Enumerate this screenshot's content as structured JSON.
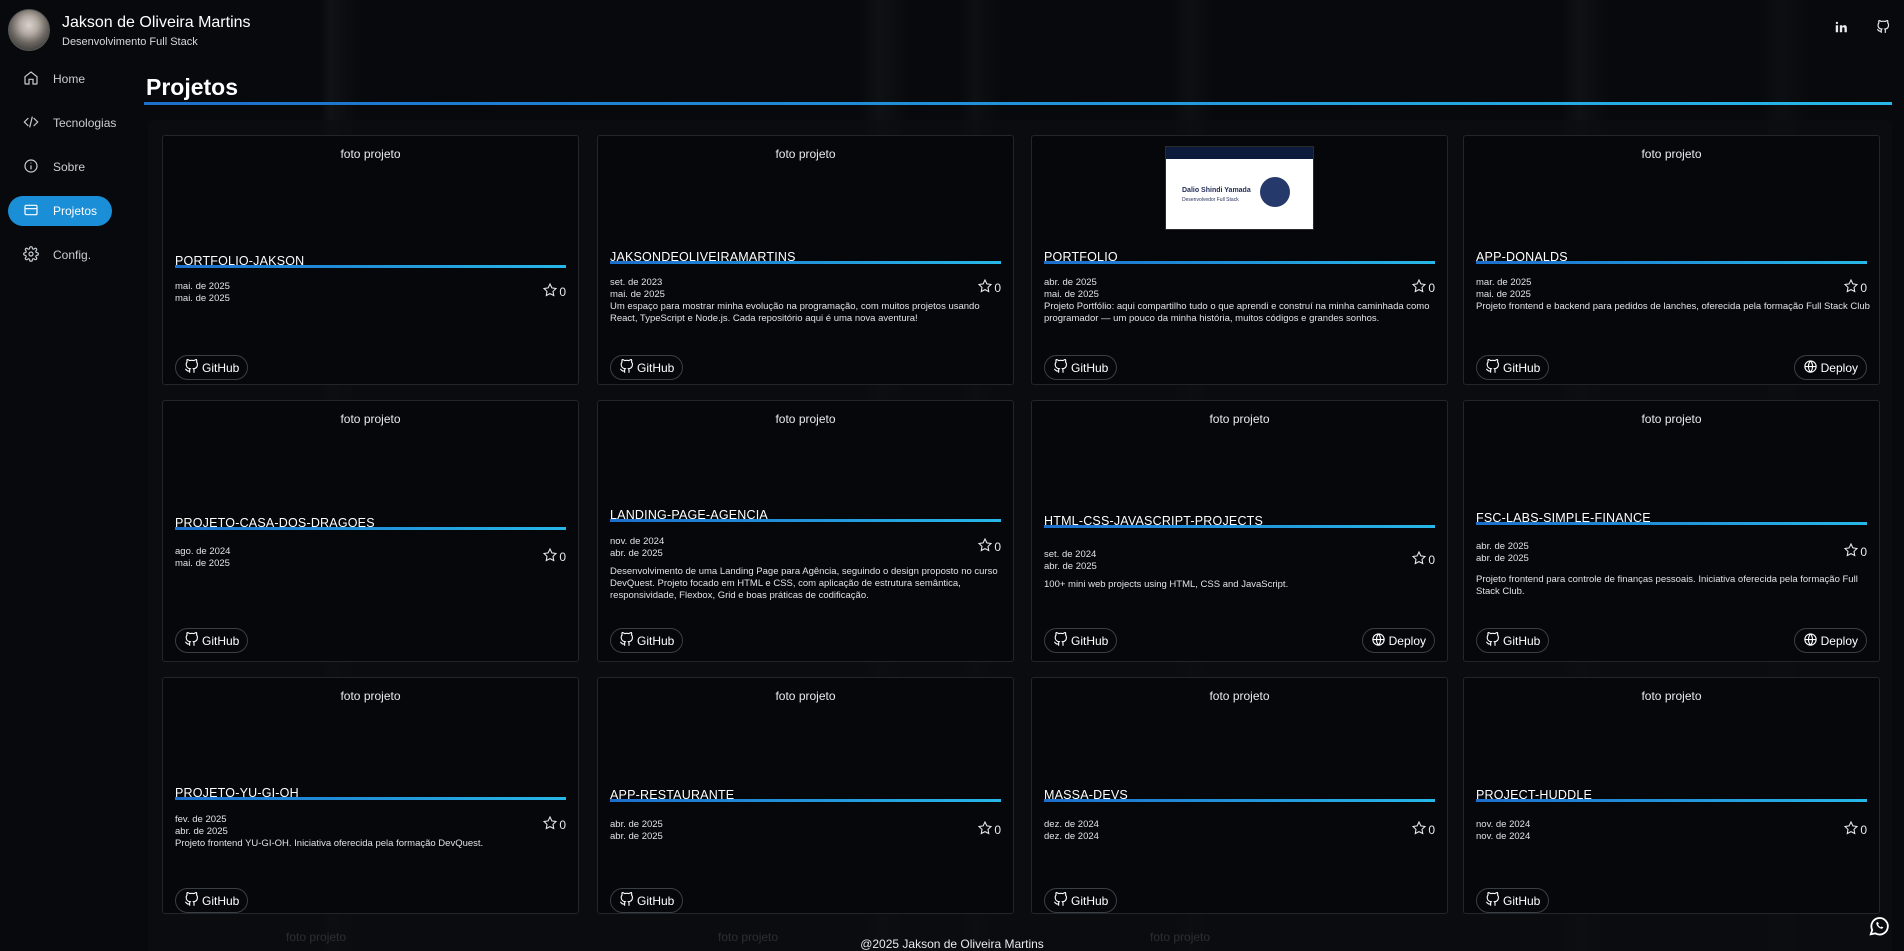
{
  "header": {
    "name": "Jakson de Oliveira Martins",
    "role": "Desenvolvimento Full Stack"
  },
  "sidebar": {
    "items": [
      {
        "label": "Home",
        "icon": "home-icon"
      },
      {
        "label": "Tecnologias",
        "icon": "code-icon"
      },
      {
        "label": "Sobre",
        "icon": "info-icon"
      },
      {
        "label": "Projetos",
        "icon": "card-icon",
        "active": true
      },
      {
        "label": "Config.",
        "icon": "gear-icon"
      }
    ]
  },
  "main": {
    "title": "Projetos",
    "image_alt": "foto projeto",
    "github_label": "GitHub",
    "deploy_label": "Deploy",
    "projects": [
      {
        "name": "PORTFOLIO-JAKSON",
        "created": "mai. de 2025",
        "updated": "mai. de 2025",
        "stars": "0",
        "description": "",
        "deploy": false
      },
      {
        "name": "JAKSONDEOLIVEIRAMARTINS",
        "created": "set. de 2023",
        "updated": "mai. de 2025",
        "stars": "0",
        "description": "Um espaço para mostrar minha evolução na programação, com muitos projetos usando React, TypeScript e Node.js. Cada repositório aqui é uma nova aventura!",
        "deploy": false
      },
      {
        "name": "PORTFOLIO",
        "created": "abr. de 2025",
        "updated": "mai. de 2025",
        "stars": "0",
        "description": "Projeto Portfólio: aqui compartilho tudo o que aprendi e construí na minha caminhada como programador — um pouco da minha história, muitos códigos e grandes sonhos.",
        "deploy": false,
        "screenshot": true,
        "shot_title": "Dalio Shindi Yamada",
        "shot_subtitle": "Desenvolvedor Full Stack"
      },
      {
        "name": "APP-DONALDS",
        "created": "mar. de 2025",
        "updated": "mai. de 2025",
        "stars": "0",
        "description": "Projeto frontend e backend para pedidos de lanches, oferecida pela formação Full Stack Club",
        "deploy": true
      },
      {
        "name": "PROJETO-CASA-DOS-DRAGOES",
        "created": "ago. de 2024",
        "updated": "mai. de 2025",
        "stars": "0",
        "description": "",
        "deploy": false
      },
      {
        "name": "LANDING-PAGE-AGENCIA",
        "created": "nov. de 2024",
        "updated": "abr. de 2025",
        "stars": "0",
        "description": "Desenvolvimento de uma Landing Page para Agência, seguindo o design proposto no curso DevQuest. Projeto focado em HTML e CSS, com aplicação de estrutura semântica, responsividade, Flexbox, Grid e boas práticas de codificação.",
        "deploy": false
      },
      {
        "name": "HTML-CSS-JAVASCRIPT-PROJECTS",
        "created": "set. de 2024",
        "updated": "abr. de 2025",
        "stars": "0",
        "description": "100+ mini web projects using HTML, CSS and JavaScript.",
        "deploy": true
      },
      {
        "name": "FSC-LABS-SIMPLE-FINANCE",
        "created": "abr. de 2025",
        "updated": "abr. de 2025",
        "stars": "0",
        "description": "Projeto frontend para controle de finanças pessoais. Iniciativa oferecida pela formação Full Stack Club.",
        "deploy": true
      },
      {
        "name": "PROJETO-YU-GI-OH",
        "created": "fev. de 2025",
        "updated": "abr. de 2025",
        "stars": "0",
        "description": "Projeto frontend YU-GI-OH. Iniciativa oferecida pela formação DevQuest.",
        "deploy": false
      },
      {
        "name": "APP-RESTAURANTE",
        "created": "abr. de 2025",
        "updated": "abr. de 2025",
        "stars": "0",
        "description": "",
        "deploy": false
      },
      {
        "name": "MASSA-DEVS",
        "created": "dez. de 2024",
        "updated": "dez. de 2024",
        "stars": "0",
        "description": "",
        "deploy": false
      },
      {
        "name": "PROJECT-HUDDLE",
        "created": "nov. de 2024",
        "updated": "nov. de 2024",
        "stars": "0",
        "description": "",
        "deploy": false
      }
    ]
  },
  "footer": {
    "text": "@2025 Jakson de Oliveira Martins"
  },
  "colors": {
    "accent": "#1a8fd8",
    "background": "#07090c",
    "card_bg": "#05070a"
  }
}
